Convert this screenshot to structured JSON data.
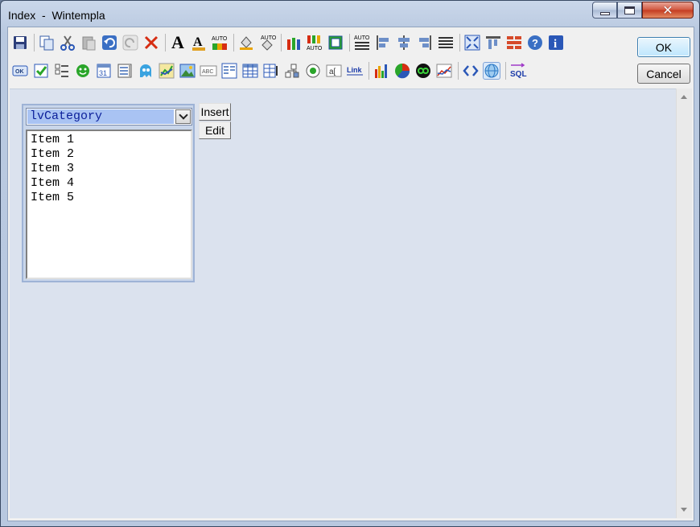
{
  "window": {
    "title": "Index  -  Wintempla",
    "caption_buttons": [
      "minimize-icon",
      "maximize-icon",
      "close-icon"
    ]
  },
  "toolbar": {
    "row1": [
      "save-icon",
      "copy-icon",
      "cut-icon",
      "paste-icon",
      "undo-icon",
      "redo-icon",
      "delete-icon",
      "font-icon",
      "font-color-icon",
      "auto-color-icon",
      "fill-color-icon",
      "auto-fill-icon",
      "pencils-icon",
      "auto-pencils-icon",
      "frame-icon",
      "auto-align-icon",
      "align-left-icon",
      "align-center-icon",
      "align-right-icon",
      "justify-icon",
      "fit-icon",
      "size-icon",
      "grid-icon",
      "help-icon",
      "info-icon"
    ],
    "row2": [
      "button-control-icon",
      "checkbox-control-icon",
      "checklist-control-icon",
      "smiley-control-icon",
      "calendar-control-icon",
      "list-control-icon",
      "ghost-control-icon",
      "chart-control-icon",
      "picture-control-icon",
      "text-control-icon",
      "listview-control-icon",
      "table-control-icon",
      "grid-control-icon",
      "tree-control-icon",
      "radio-control-icon",
      "label-control-icon",
      "link-control-icon",
      "bar-chart-icon",
      "pie-chart-icon",
      "infinity-icon",
      "line-chart-icon",
      "code-icon",
      "web-icon",
      "sql-icon"
    ],
    "auto_label": "AUTO",
    "calendar_label": "31",
    "abc_label": "ABC",
    "link_label": "Link",
    "sql_label": "SQL",
    "ok_label": "OK"
  },
  "dialog_buttons": {
    "ok": "OK",
    "cancel": "Cancel"
  },
  "design": {
    "combo_value": "lvCategory",
    "list_items": [
      "Item 1",
      "Item 2",
      "Item 3",
      "Item 4",
      "Item 5"
    ],
    "insert_label": "Insert",
    "edit_label": "Edit"
  }
}
